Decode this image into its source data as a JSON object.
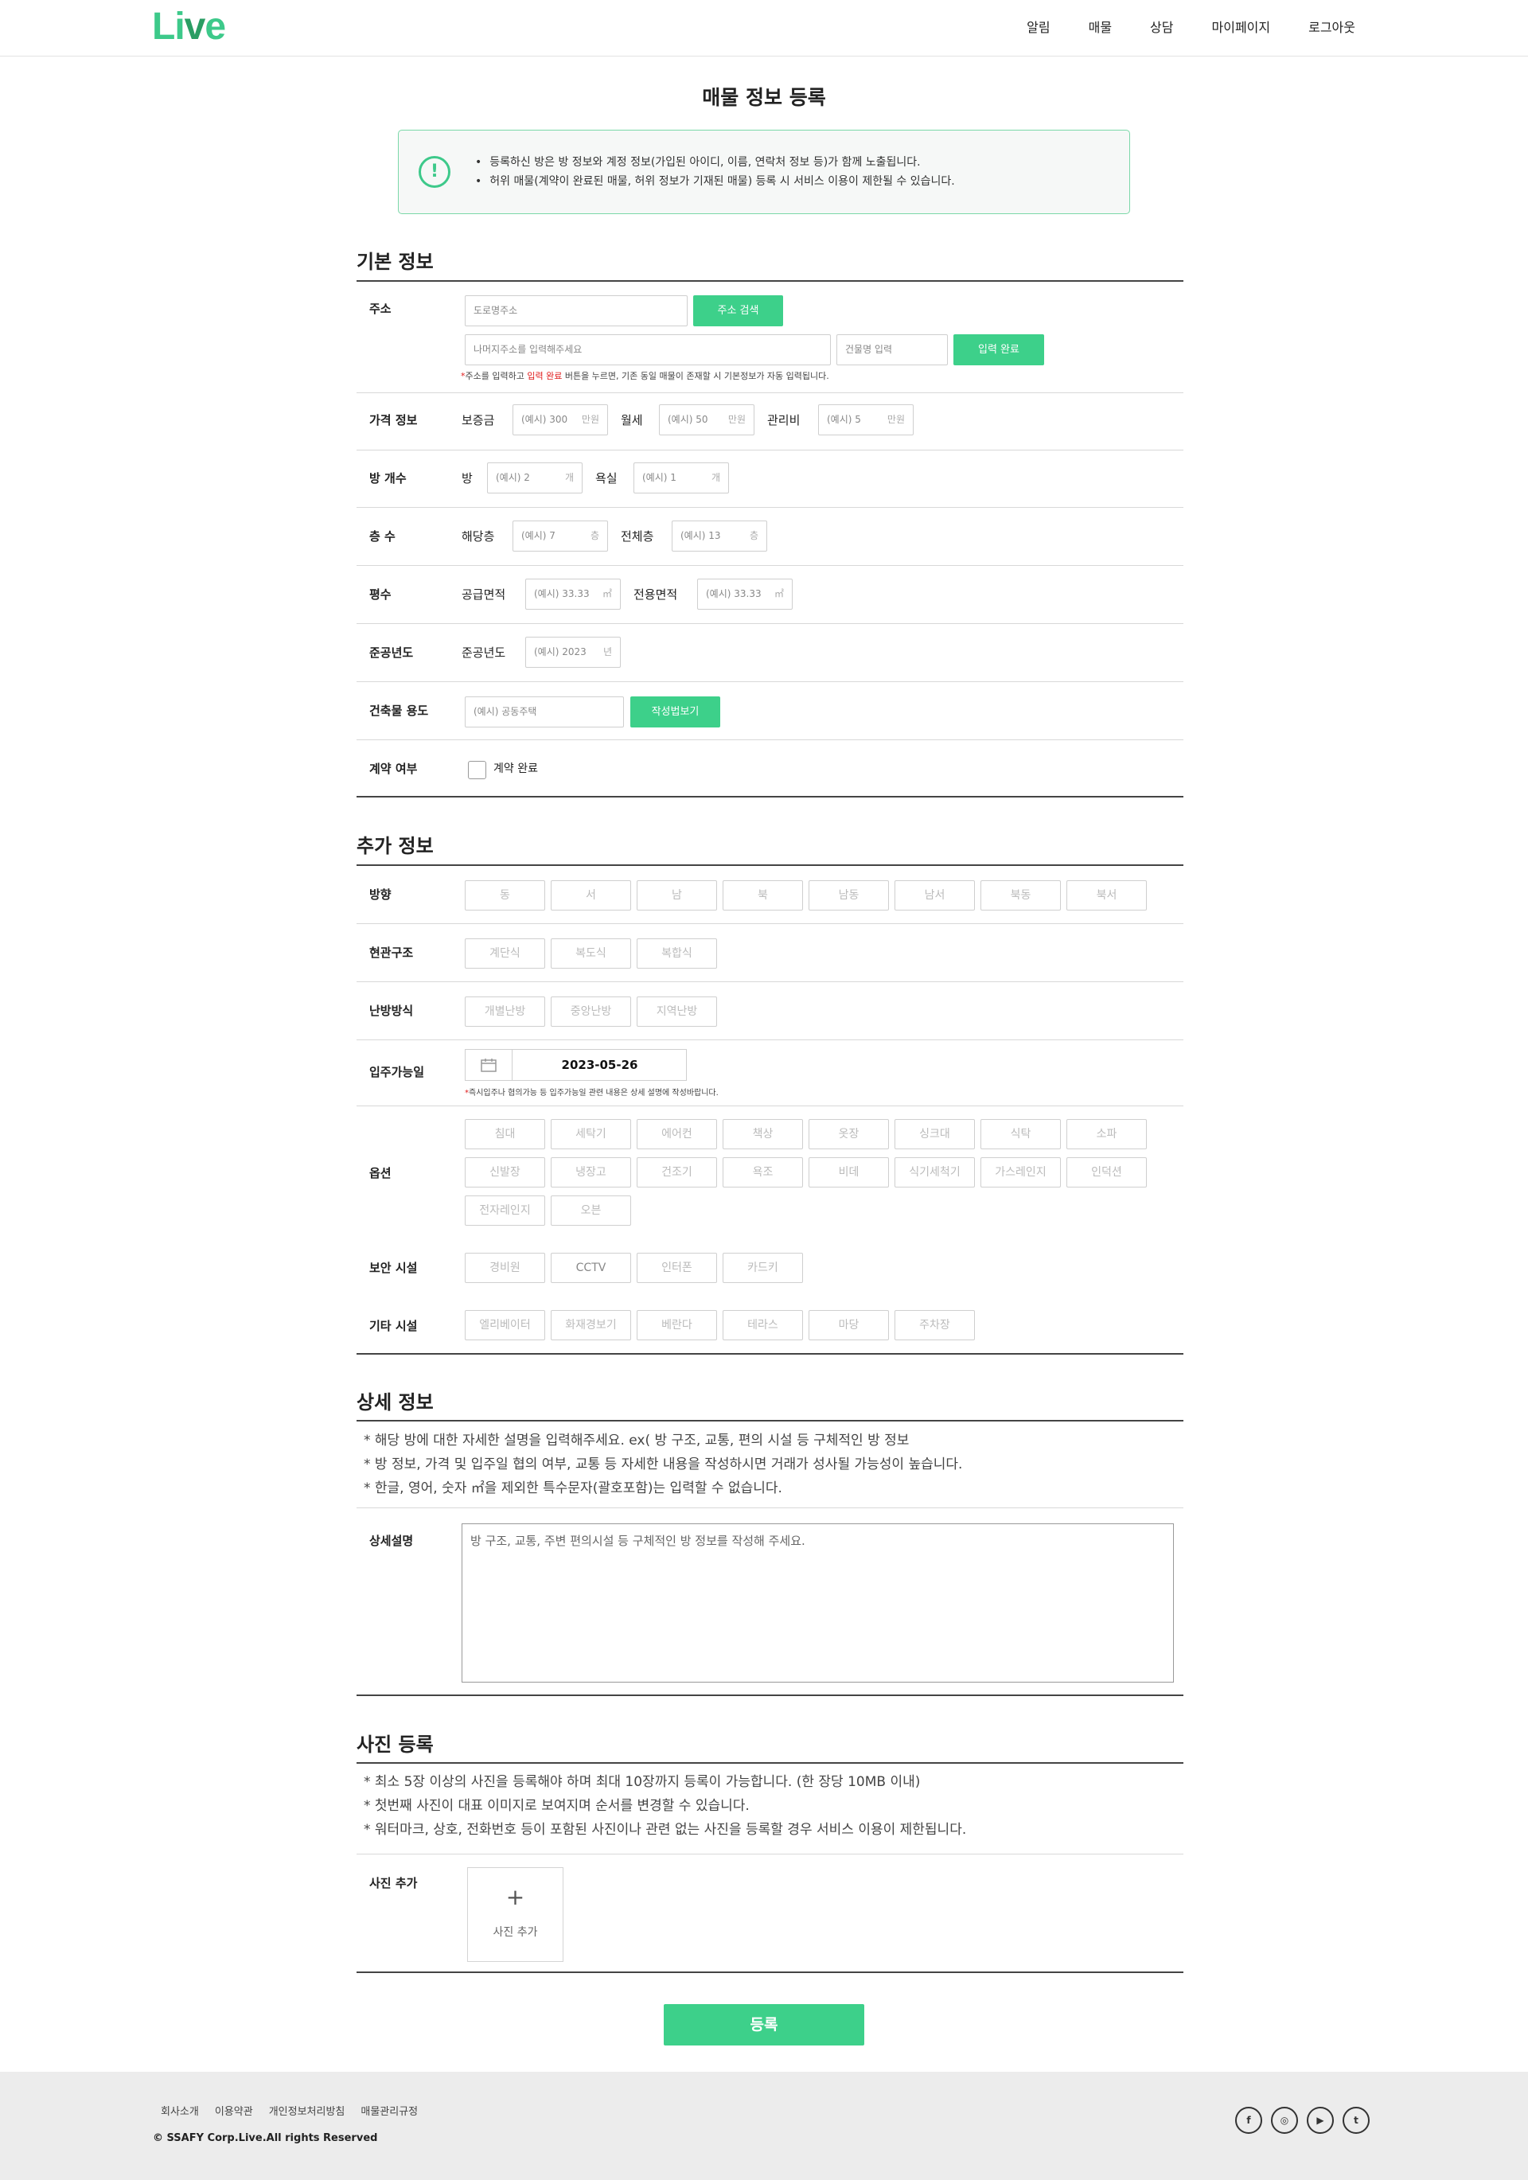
{
  "header": {
    "logo": "Live",
    "nav": [
      "알림",
      "매물",
      "상담",
      "마이페이지",
      "로그아웃"
    ]
  },
  "page_title": "매물 정보 등록",
  "notice": {
    "lines": [
      "등록하신 방은 방 정보와 계정 정보(가입된 아이디, 이름, 연락처 정보 등)가 함께 노출됩니다.",
      "허위 매물(계약이 완료된 매물, 허위 정보가 기재된 매물) 등록 시 서비스 이용이 제한될 수 있습니다."
    ]
  },
  "basic": {
    "title": "기본 정보",
    "address": {
      "label": "주소",
      "road_placeholder": "도로명주소",
      "search_button": "주소 검색",
      "detail_placeholder": "나머지주소를 입력해주세요",
      "building_placeholder": "건물명 입력",
      "done_button": "입력 완료",
      "hint_a": "주소를 입력하고 ",
      "hint_b": "입력 완료",
      "hint_c": " 버튼을 누르면, 기존 동일 매물이 존재할 시 기본정보가 자동 입력됩니다."
    },
    "price": {
      "label": "가격 정보",
      "deposit": "보증금",
      "deposit_ph": "(예시) 300",
      "deposit_unit": "만원",
      "monthly": "월세",
      "monthly_ph": "(예시) 50",
      "monthly_unit": "만원",
      "fee": "관리비",
      "fee_ph": "(예시) 5",
      "fee_unit": "만원"
    },
    "rooms": {
      "label": "방 개수",
      "room": "방",
      "room_ph": "(예시) 2",
      "room_unit": "개",
      "bath": "욕실",
      "bath_ph": "(예시) 1",
      "bath_unit": "개"
    },
    "floors": {
      "label": "층 수",
      "cur": "해당층",
      "cur_ph": "(예시) 7",
      "cur_unit": "층",
      "total": "전체층",
      "total_ph": "(예시) 13",
      "total_unit": "층"
    },
    "area": {
      "label": "평수",
      "supply": "공급면적",
      "supply_ph": "(예시) 33.33",
      "supply_unit": "㎡",
      "exclusive": "전용면적",
      "exclusive_ph": "(예시) 33.33",
      "exclusive_unit": "㎡"
    },
    "year": {
      "label": "준공년도",
      "sub": "준공년도",
      "ph": "(예시) 2023",
      "unit": "년"
    },
    "usage": {
      "label": "건축물 용도",
      "ph": "(예시) 공동주택",
      "button": "작성법보기"
    },
    "contract": {
      "label": "계약 여부",
      "checkbox_label": "계약 완료"
    }
  },
  "extra": {
    "title": "추가 정보",
    "direction": {
      "label": "방향",
      "options": [
        "동",
        "서",
        "남",
        "북",
        "남동",
        "남서",
        "북동",
        "북서"
      ]
    },
    "structure": {
      "label": "현관구조",
      "options": [
        "계단식",
        "복도식",
        "복합식"
      ]
    },
    "heating": {
      "label": "난방방식",
      "options": [
        "개별난방",
        "중앙난방",
        "지역난방"
      ]
    },
    "move_in": {
      "label": "입주가능일",
      "date": "2023-05-26",
      "hint": "즉시입주나 협의가능 등 입주가능일 관련 내용은 상세 설명에 작성바랍니다."
    },
    "options": {
      "label": "옵션",
      "items": [
        "침대",
        "세탁기",
        "에어컨",
        "책상",
        "옷장",
        "싱크대",
        "식탁",
        "소파",
        "신발장",
        "냉장고",
        "건조기",
        "욕조",
        "비데",
        "식기세척기",
        "가스레인지",
        "인덕션",
        "전자레인지",
        "오븐"
      ]
    },
    "security": {
      "label": "보안 시설",
      "options": [
        "경비원",
        "CCTV",
        "인터폰",
        "카드키"
      ]
    },
    "others": {
      "label": "기타 시설",
      "options": [
        "엘리베이터",
        "화재경보기",
        "베란다",
        "테라스",
        "마당",
        "주차장"
      ]
    }
  },
  "detail": {
    "title": "상세 정보",
    "notes": [
      "* 해당 방에 대한 자세한 설명을 입력해주세요. ex( 방 구조, 교통, 편의 시설 등 구체적인 방 정보",
      "* 방 정보, 가격 및 입주일 협의 여부, 교통 등 자세한 내용을 작성하시면 거래가 성사될 가능성이 높습니다.",
      "* 한글, 영어, 숫자 ㎡을 제외한 특수문자(괄호포함)는 입력할 수 없습니다."
    ],
    "label": "상세설명",
    "placeholder": "방 구조, 교통, 주변 편의시설 등 구체적인 방 정보를 작성해 주세요."
  },
  "photos": {
    "title": "사진 등록",
    "notes": [
      "* 최소 5장 이상의 사진을 등록해야 하며 최대 10장까지 등록이 가능합니다. (한 장당 10MB 이내)",
      "* 첫번째 사진이 대표 이미지로 보여지며 순서를 변경할 수 있습니다.",
      "* 워터마크, 상호, 전화번호 등이 포함된 사진이나 관련 없는 사진을 등록할 경우 서비스 이용이 제한됩니다."
    ],
    "label": "사진 추가",
    "add_plus": "+",
    "add_label": "사진 추가"
  },
  "submit": "등록",
  "footer": {
    "links": [
      "회사소개",
      "이용약관",
      "개인정보처리방침",
      "매물관리규정"
    ],
    "copyright": "© SSAFY Corp.Live.All rights Reserved",
    "social_icons": [
      "facebook-icon",
      "instagram-icon",
      "youtube-icon",
      "twitter-icon"
    ],
    "social_glyphs": [
      "f",
      "◎",
      "▶",
      "t"
    ]
  }
}
